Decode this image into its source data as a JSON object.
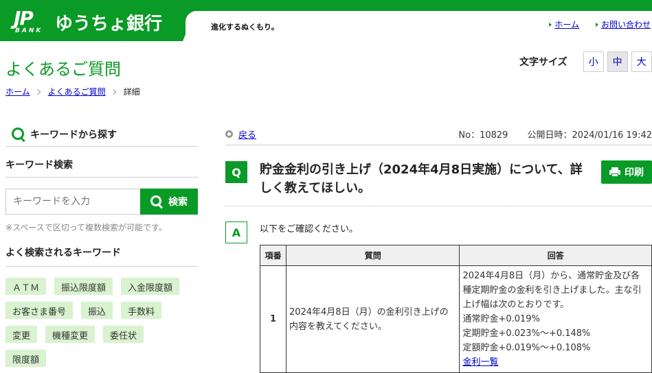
{
  "header": {
    "logo_mark": "JP",
    "logo_sub": "BANK",
    "bank_name": "ゆうちょ銀行",
    "slogan": "進化するぬくもり。",
    "links": [
      "ホーム",
      "お問い合わせ"
    ]
  },
  "page": {
    "title": "よくあるご質問",
    "font_size_label": "文字サイズ",
    "font_sizes": [
      "小",
      "中",
      "大"
    ],
    "font_size_selected": "中"
  },
  "breadcrumb": [
    "ホーム",
    "よくあるご質問",
    "詳細"
  ],
  "sidebar": {
    "heading": "キーワードから探す",
    "keyword_search_title": "キーワード検索",
    "search_placeholder": "キーワードを入力",
    "search_button": "検索",
    "note": "※スペースで区切って複数検索が可能です。",
    "popular_title": "よく検索されるキーワード",
    "tags": [
      "ＡＴＭ",
      "振込限度額",
      "入金限度額",
      "お客さま番号",
      "振込",
      "手数料",
      "変更",
      "機種変更",
      "委任状",
      "限度額"
    ]
  },
  "main": {
    "back_label": "戻る",
    "number": "No：10829",
    "published": "公開日時：2024/01/16 19:42",
    "q_badge": "Q",
    "question": "貯金金利の引き上げ（2024年4月8日実施）について、詳しく教えてほしい。",
    "print_label": "印刷",
    "a_badge": "A",
    "answer_intro": "以下をご確認ください。",
    "table": {
      "headers": [
        "項番",
        "質問",
        "回答"
      ],
      "rows": [
        {
          "no": "1",
          "question": "2024年4月8日（月）の金利引き上げの内容を教えてください。",
          "answer_lines": [
            "2024年4月8日（月）から、通常貯金及び各種定期貯金の金利を引き上げました。主な引上げ幅は次のとおりです。",
            "通常貯金+0.019%",
            "定期貯金+0.023%～+0.148%",
            "定額貯金+0.019%～+0.108%"
          ],
          "answer_link": "金利一覧"
        }
      ]
    }
  },
  "colors": {
    "brand_green": "#0a9a26",
    "tag_bg": "#d9f2cf",
    "link": "#0000cc"
  }
}
